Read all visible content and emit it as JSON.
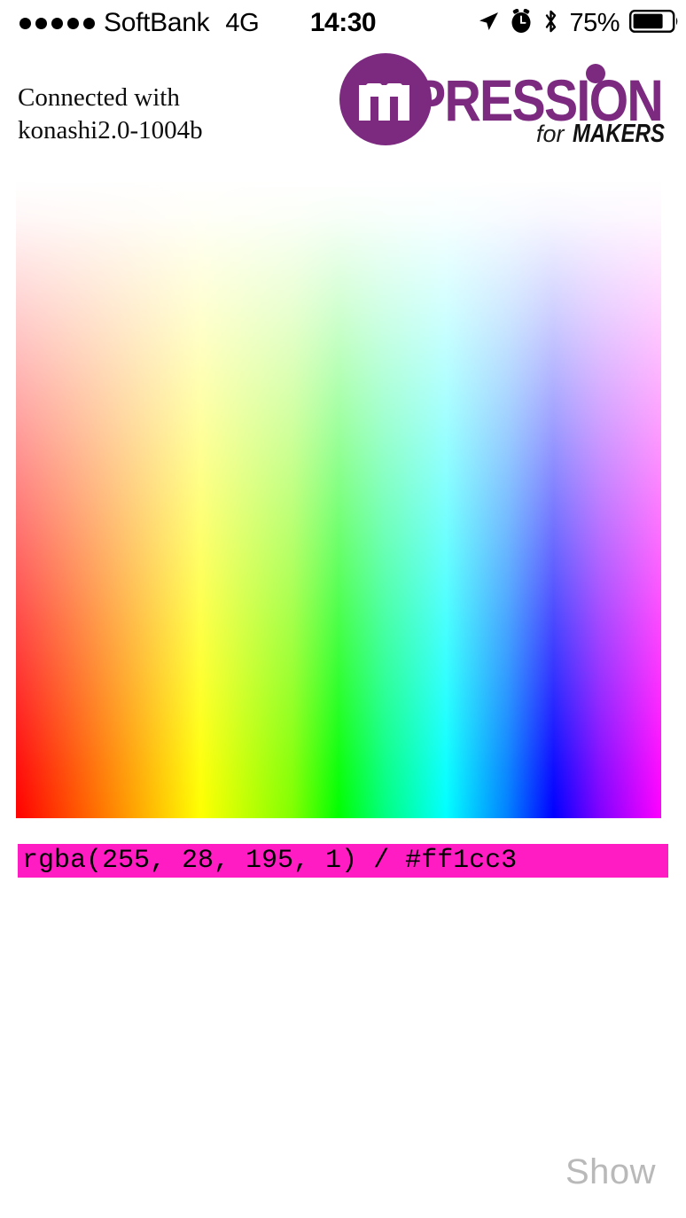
{
  "status_bar": {
    "signal_dots": 5,
    "carrier": "SoftBank",
    "network": "4G",
    "time": "14:30",
    "battery_percent": "75%",
    "icons": {
      "location": "location-arrow-icon",
      "alarm": "alarm-clock-icon",
      "bluetooth": "bluetooth-icon",
      "battery": "battery-icon"
    }
  },
  "header": {
    "connection_line1": "Connected with",
    "connection_line2": "konashi2.0-1004b"
  },
  "logo": {
    "mark_letter": "m",
    "word": "PRESSION",
    "tagline_light": "for",
    "tagline_bold": "MAKERS",
    "purple": "#7b2a80",
    "black": "#111111"
  },
  "color_picker": {
    "name": "hue-saturation-gradient",
    "hue_stops": [
      "#ff0000",
      "#ff8000",
      "#ffff00",
      "#80ff00",
      "#00ff00",
      "#00ff80",
      "#00ffff",
      "#0080ff",
      "#0000ff",
      "#8000ff",
      "#ff00ff"
    ],
    "vertical_axis": "white-to-saturated"
  },
  "selected_color": {
    "label": "rgba(255, 28, 195, 1) / #ff1cc3",
    "rgba": "rgba(255, 28, 195, 1)",
    "hex": "#ff1cc3",
    "r": 255,
    "g": 28,
    "b": 195,
    "a": 1
  },
  "footer": {
    "show_label": "Show"
  }
}
